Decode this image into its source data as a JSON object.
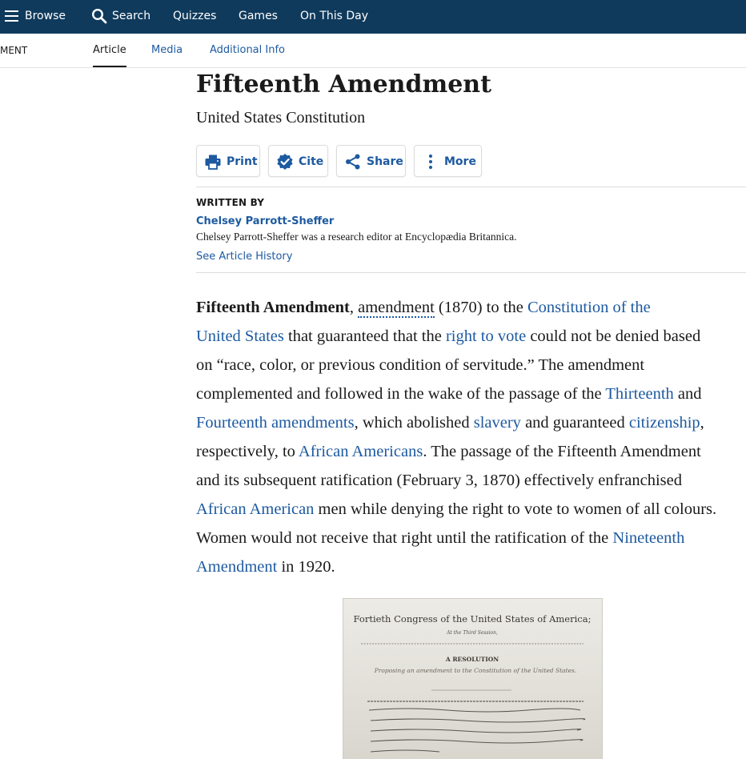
{
  "topnav": {
    "browse": "Browse",
    "search": "Search",
    "quizzes": "Quizzes",
    "games": "Games",
    "on_this_day": "On This Day"
  },
  "subnav": {
    "truncated_title": "MENT",
    "article": "Article",
    "media": "Media",
    "additional_info": "Additional Info"
  },
  "header": {
    "title": "Fifteenth Amendment",
    "subtitle": "United States Constitution"
  },
  "actions": {
    "print": "Print",
    "cite": "Cite",
    "share": "Share",
    "more": "More"
  },
  "byline": {
    "written_by": "WRITTEN BY",
    "author": "Chelsey Parrott-Sheffer",
    "bio": "Chelsey Parrott-Sheffer was a research editor at Encyclopædia Britannica.",
    "history": "See Article History"
  },
  "article": {
    "l1_bold": "Fifteenth Amendment",
    "l1_comma": ", ",
    "l1_amendment": "amendment",
    "l1_mid": " (1870) to the ",
    "l1_link": "Constitution of the",
    "l2_link": "United States",
    "l2_mid": " that guaranteed that the ",
    "l2_link2": "right to vote",
    "l2_end": " could not be denied based",
    "l3": "on “race, color, or previous condition of servitude.” The amendment",
    "l4_text": "complemented and followed in the wake of the passage of the ",
    "l4_link": "Thirteenth",
    "l4_end": " and",
    "l5_link": "Fourteenth amendments",
    "l5_mid": ", which abolished ",
    "l5_link2": "slavery",
    "l5_mid2": " and guaranteed ",
    "l5_link3": "citizenship",
    "l5_end": ",",
    "l6_text": "respectively, to ",
    "l6_link": "African Americans",
    "l6_end": ". The passage of the Fifteenth Amendment",
    "l7": "and its subsequent ratification (February 3, 1870) effectively enfranchised",
    "l8_link": "African American",
    "l8_end": " men while denying the right to vote to women of all colours.",
    "l9_text": "Women would not receive that right until the ratification of the ",
    "l9_link": "Nineteenth",
    "l10_link": "Amendment",
    "l10_end": " in 1920."
  },
  "document_image": {
    "heading": "Fortieth Congress of the United States of America;",
    "session_line": "At the Third Session,",
    "resolution": "A RESOLUTION",
    "resolution_subtitle": "Proposing an amendment to the Constitution of the United States."
  },
  "colors": {
    "nav_bg": "#0f3a5c",
    "link": "#1d5aa0",
    "text": "#1a1a1a"
  }
}
